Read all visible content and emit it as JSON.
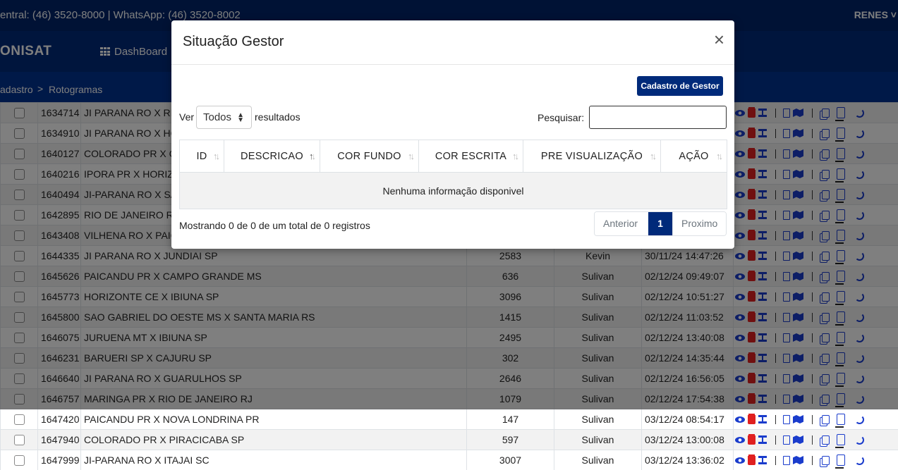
{
  "topbar": {
    "contact": "entral: (46) 3520-8000 | WhatsApp: (46) 3520-8002",
    "user": "RENES ˅"
  },
  "navbar": {
    "brand": "ONISAT",
    "dashboard": "DashBoard"
  },
  "breadcrumb": {
    "item1": "adastro",
    "separator": ">",
    "item2": "Rotogramas"
  },
  "rows": [
    {
      "id": "1634714",
      "desc": "JI PARANA RO X RI",
      "km": "",
      "user": "",
      "date": ""
    },
    {
      "id": "1634910",
      "desc": "JI PARANA RO X HO",
      "km": "",
      "user": "",
      "date": ""
    },
    {
      "id": "1640127",
      "desc": "COLORADO PR X C",
      "km": "",
      "user": "",
      "date": ""
    },
    {
      "id": "1640216",
      "desc": "IPORA PR X HORIZ",
      "km": "",
      "user": "",
      "date": ""
    },
    {
      "id": "1640494",
      "desc": "JI-PARANA RO X SA",
      "km": "",
      "user": "",
      "date": ""
    },
    {
      "id": "1642895",
      "desc": "RIO DE JANEIRO RJ",
      "km": "",
      "user": "",
      "date": ""
    },
    {
      "id": "1643408",
      "desc": "VILHENA RO X PAIC",
      "km": "",
      "user": "",
      "date": ""
    },
    {
      "id": "1644335",
      "desc": "JI PARANA RO X JUNDIAI SP",
      "km": "2583",
      "user": "Kevin",
      "date": "30/11/24 14:47:26"
    },
    {
      "id": "1645626",
      "desc": "PAICANDU PR X CAMPO GRANDE MS",
      "km": "636",
      "user": "Sulivan",
      "date": "02/12/24 09:49:07"
    },
    {
      "id": "1645773",
      "desc": "HORIZONTE CE X IBIUNA SP",
      "km": "3096",
      "user": "Sulivan",
      "date": "02/12/24 10:51:27"
    },
    {
      "id": "1645800",
      "desc": "SAO GABRIEL DO OESTE MS X SANTA MARIA RS",
      "km": "1415",
      "user": "Sulivan",
      "date": "02/12/24 11:03:52"
    },
    {
      "id": "1646075",
      "desc": "JURUENA MT X IBIUNA SP",
      "km": "2495",
      "user": "Sulivan",
      "date": "02/12/24 13:40:08"
    },
    {
      "id": "1646231",
      "desc": "BARUERI SP X CAJURU SP",
      "km": "302",
      "user": "Sulivan",
      "date": "02/12/24 14:35:44"
    },
    {
      "id": "1646640",
      "desc": "JI PARANA RO X GUARULHOS SP",
      "km": "2646",
      "user": "Sulivan",
      "date": "02/12/24 16:56:05"
    },
    {
      "id": "1646757",
      "desc": "MARINGA PR X RIO DE JANEIRO RJ",
      "km": "1079",
      "user": "Sulivan",
      "date": "02/12/24 17:54:38"
    },
    {
      "id": "1647420",
      "desc": "PAICANDU PR X NOVA LONDRINA PR",
      "km": "147",
      "user": "Sulivan",
      "date": "03/12/24 08:54:17"
    },
    {
      "id": "1647940",
      "desc": "COLORADO PR X PIRACICABA SP",
      "km": "597",
      "user": "Sulivan",
      "date": "03/12/24 13:00:08"
    },
    {
      "id": "1647999",
      "desc": "JI-PARANA RO X ITAJAI SC",
      "km": "3007",
      "user": "Sulivan",
      "date": "03/12/24 13:36:02"
    }
  ],
  "modal": {
    "title": "Situação Gestor",
    "close": "×",
    "cadastro_button": "Cadastro de Gestor",
    "length_label": "Ver",
    "length_value": "Todos",
    "length_after": "resultados",
    "search_label": "Pesquisar:",
    "search_value": "",
    "columns": [
      "ID",
      "DESCRICAO",
      "COR FUNDO",
      "COR ESCRITA",
      "PRE VISUALIZAÇÃO",
      "AÇÃO"
    ],
    "empty_message": "Nenhuma informação disponivel",
    "info": "Mostrando 0 de 0 de um total de 0 registros",
    "pager": {
      "previous": "Anterior",
      "current": "1",
      "next": "Proximo"
    }
  },
  "colors": {
    "navy": "#00246b",
    "primary": "#002a7a",
    "danger": "#e02020",
    "icon_blue": "#1a3ccc"
  },
  "icons": [
    "eye-icon",
    "trash-icon",
    "route-icon",
    "pdf-icon",
    "map-icon",
    "copy-icon",
    "swap-icon",
    "share-icon",
    "close-icon",
    "sort-icon",
    "grid-icon"
  ]
}
